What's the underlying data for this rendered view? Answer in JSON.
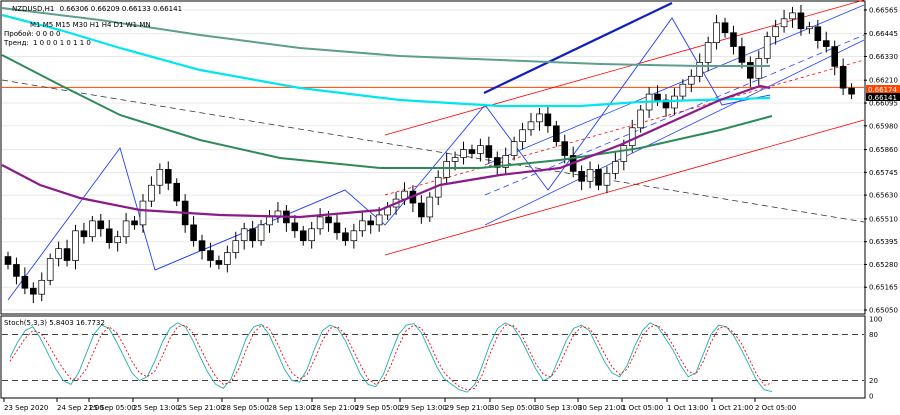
{
  "header": {
    "instrument": "NZDUSD,H1",
    "ohlc": "0.66306 0.66209 0.66133 0.66141",
    "timeframes": "M1 M5 M15 M30 H1 H4 D1 W1 MN",
    "breakout_label": "Пробой:",
    "breakout_values": "0   0       0       0",
    "trend_label": "Тренд:",
    "trend_values": "1   0   0   0   1   0   1   1   0"
  },
  "chart_data": [
    {
      "type": "candlestick",
      "panel": "price",
      "title": "NZDUSD,H1",
      "ylim": [
        0.65035,
        0.66605
      ],
      "y_ticks": [
        "0.66565",
        "0.66445",
        "0.66330",
        "0.66210",
        "0.66095",
        "0.65980",
        "0.65860",
        "0.65745",
        "0.65630",
        "0.65510",
        "0.65395",
        "0.65280",
        "0.65165",
        "0.65050"
      ],
      "x_ticks": [
        "23 Sep 2020",
        "24 Sep 21:00",
        "25 Sep 05:00",
        "25 Sep 13:00",
        "25 Sep 21:00",
        "28 Sep 05:00",
        "28 Sep 13:00",
        "28 Sep 21:00",
        "29 Sep 05:00",
        "29 Sep 13:00",
        "29 Sep 21:00",
        "30 Sep 05:00",
        "30 Sep 13:00",
        "30 Sep 21:00",
        "1 Oct 05:00",
        "1 Oct 13:00",
        "1 Oct 21:00",
        "2 Oct 05:00"
      ],
      "price_marker_1": "0.66174",
      "price_marker_2": "0.66141",
      "candles_close_approx": [
        0.6528,
        0.6522,
        0.6516,
        0.6513,
        0.652,
        0.6531,
        0.6536,
        0.653,
        0.6545,
        0.6542,
        0.655,
        0.6546,
        0.6539,
        0.6542,
        0.655,
        0.6548,
        0.656,
        0.6568,
        0.6576,
        0.6569,
        0.656,
        0.6548,
        0.654,
        0.6535,
        0.653,
        0.6528,
        0.6534,
        0.654,
        0.6546,
        0.654,
        0.6548,
        0.6552,
        0.6555,
        0.6549,
        0.6545,
        0.654,
        0.6546,
        0.6552,
        0.6549,
        0.6544,
        0.654,
        0.6545,
        0.655,
        0.6548,
        0.6553,
        0.6557,
        0.6561,
        0.6565,
        0.6559,
        0.6552,
        0.6562,
        0.6572,
        0.658,
        0.6582,
        0.6586,
        0.6584,
        0.6588,
        0.6582,
        0.6577,
        0.6583,
        0.659,
        0.6596,
        0.66,
        0.6604,
        0.6598,
        0.659,
        0.6583,
        0.6575,
        0.657,
        0.6576,
        0.6568,
        0.6574,
        0.658,
        0.6588,
        0.6597,
        0.6606,
        0.6614,
        0.6611,
        0.6607,
        0.6613,
        0.6619,
        0.6623,
        0.663,
        0.664,
        0.665,
        0.6645,
        0.6638,
        0.663,
        0.6622,
        0.6632,
        0.6643,
        0.6648,
        0.6652,
        0.6655,
        0.6647,
        0.6648,
        0.6641,
        0.6638,
        0.6628,
        0.6617,
        0.6614
      ],
      "indicators": [
        "moving average (cyan)",
        "moving average (grey-green)",
        "moving average (green)",
        "moving average (purple)",
        "trend channels (red, blue)",
        "zigzag (blue)"
      ],
      "ylabel": "",
      "xlabel": ""
    },
    {
      "type": "line",
      "panel": "oscillator",
      "title": "Stoch(5,3,3) 5.8403 16.7732",
      "ylim": [
        0,
        100
      ],
      "y_ticks": [
        "100",
        "80",
        "20",
        "0"
      ],
      "levels": [
        80,
        20
      ],
      "series": [
        {
          "name": "main",
          "color": "#20b2aa",
          "values": [
            50,
            70,
            85,
            90,
            75,
            55,
            35,
            20,
            15,
            30,
            55,
            80,
            92,
            88,
            70,
            50,
            30,
            20,
            25,
            45,
            70,
            88,
            95,
            90,
            72,
            50,
            30,
            15,
            10,
            22,
            48,
            75,
            90,
            93,
            80,
            58,
            35,
            20,
            18,
            35,
            62,
            85,
            92,
            88,
            72,
            50,
            28,
            15,
            12,
            28,
            55,
            80,
            92,
            94,
            82,
            60,
            38,
            22,
            15,
            8,
            5,
            15,
            40,
            68,
            88,
            95,
            90,
            75,
            55,
            35,
            20,
            25,
            48,
            72,
            88,
            92,
            85,
            65,
            45,
            30,
            25,
            40,
            65,
            85,
            95,
            90,
            75,
            60,
            40,
            25,
            30,
            55,
            80,
            92,
            90,
            78,
            60,
            40,
            20,
            8,
            5.8
          ]
        },
        {
          "name": "signal",
          "color": "#ff0000",
          "values": [
            45,
            60,
            75,
            85,
            82,
            68,
            50,
            35,
            22,
            22,
            35,
            58,
            80,
            90,
            82,
            65,
            45,
            30,
            25,
            32,
            52,
            75,
            90,
            92,
            82,
            62,
            42,
            25,
            15,
            18,
            35,
            60,
            82,
            92,
            88,
            70,
            48,
            30,
            22,
            28,
            48,
            72,
            88,
            90,
            80,
            60,
            40,
            22,
            15,
            20,
            40,
            65,
            85,
            92,
            88,
            70,
            48,
            30,
            20,
            12,
            8,
            10,
            28,
            55,
            78,
            92,
            92,
            82,
            62,
            42,
            28,
            25,
            38,
            60,
            80,
            90,
            88,
            75,
            55,
            38,
            28,
            35,
            55,
            78,
            90,
            92,
            82,
            66,
            48,
            32,
            28,
            45,
            70,
            88,
            90,
            82,
            68,
            48,
            28,
            14,
            16.8
          ]
        }
      ]
    }
  ]
}
